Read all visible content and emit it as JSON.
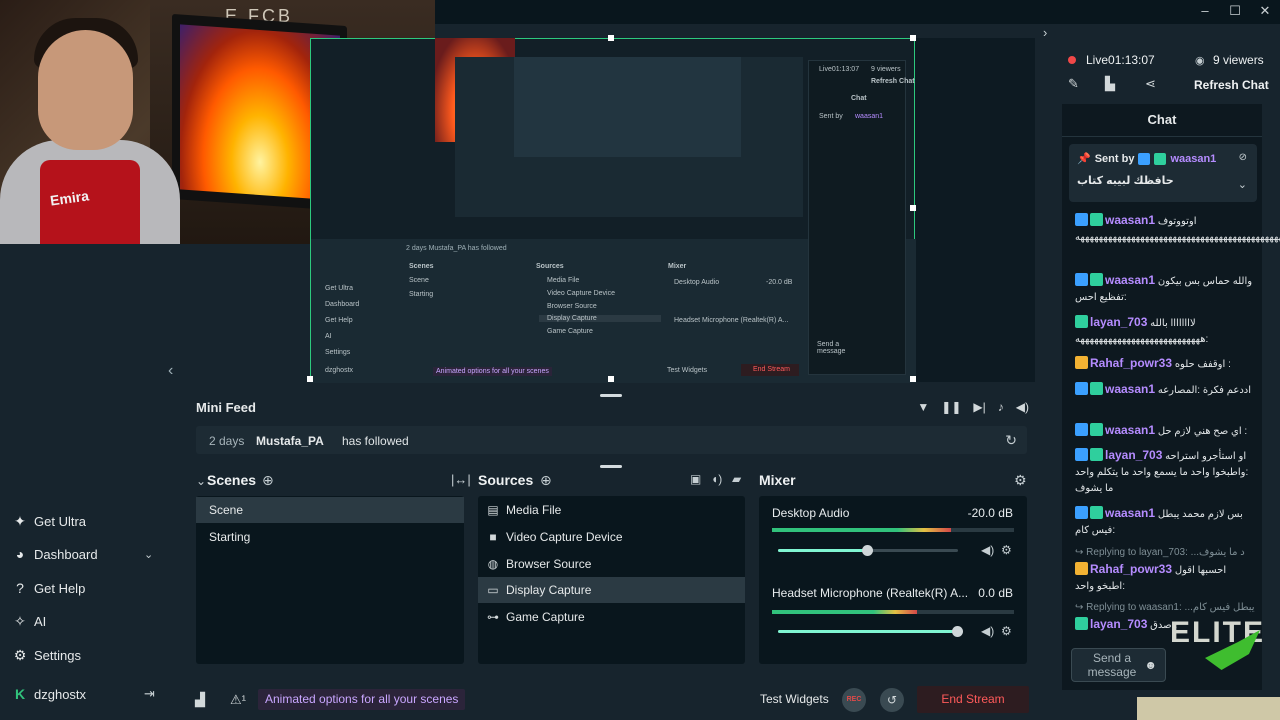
{
  "webcam": {
    "wall_text": "E.FCB",
    "shirt_text": "Emira"
  },
  "window_controls": [
    "–",
    "☐",
    "✕"
  ],
  "preview": {
    "nested_labels": {
      "live": "Live01:13:07",
      "viewers": "9 viewers",
      "refresh": "Refresh Chat",
      "chat": "Chat",
      "sent_by": "Sent by",
      "sent_user": "waasan1",
      "feed": "2 days  Mustafa_PA  has followed",
      "scenes": "Scenes",
      "sources": "Sources",
      "mixer": "Mixer",
      "scene1": "Scene",
      "scene2": "Starting",
      "src": [
        "Media File",
        "Video Capture Device",
        "Browser Source",
        "Display Capture",
        "Game Capture"
      ],
      "mix1": "Desktop Audio",
      "mix1_db": "-20.0 dB",
      "mix2": "Headset Microphone (Realtek(R) A...",
      "side": [
        "Get Ultra",
        "Dashboard",
        "Get Help",
        "AI",
        "Settings",
        "dzghostx"
      ],
      "promo": "Animated options for all your scenes",
      "test": "Test Widgets",
      "end": "End Stream",
      "send": "Send a message"
    }
  },
  "sidebar": {
    "items": [
      {
        "label": "Get Ultra",
        "icon": "ultra-icon"
      },
      {
        "label": "Dashboard",
        "icon": "dashboard-icon"
      },
      {
        "label": "Get Help",
        "icon": "help-icon"
      },
      {
        "label": "AI",
        "icon": "ai-sparkle-icon"
      },
      {
        "label": "Settings",
        "icon": "gear-icon"
      }
    ],
    "account": "dzghostx"
  },
  "minifeed": {
    "title": "Mini Feed",
    "event": {
      "time": "2 days",
      "user": "Mustafa_PA",
      "action": "has followed"
    }
  },
  "scenes": {
    "title": "Scenes",
    "items": [
      "Scene",
      "Starting"
    ],
    "active_index": 0
  },
  "sources": {
    "title": "Sources",
    "items": [
      {
        "label": "Media File",
        "icon": "file-icon"
      },
      {
        "label": "Video Capture Device",
        "icon": "camera-icon"
      },
      {
        "label": "Browser Source",
        "icon": "globe-icon"
      },
      {
        "label": "Display Capture",
        "icon": "monitor-icon"
      },
      {
        "label": "Game Capture",
        "icon": "gamepad-icon"
      }
    ],
    "active_index": 3
  },
  "mixer": {
    "title": "Mixer",
    "channels": [
      {
        "name": "Desktop Audio",
        "db": "-20.0 dB",
        "level": 0.74,
        "volume": 0.5
      },
      {
        "name": "Headset Microphone (Realtek(R) A...",
        "db": "0.0 dB",
        "level": 0.6,
        "volume": 1.0
      }
    ]
  },
  "footer": {
    "promo": "Animated options for all your scenes",
    "test_widgets": "Test Widgets",
    "rec": "REC",
    "end_stream": "End Stream"
  },
  "stream": {
    "live_label": "Live",
    "time": "01:13:07",
    "viewers": "9 viewers",
    "refresh_chat": "Refresh Chat"
  },
  "chat": {
    "title": "Chat",
    "pinned": {
      "sent_by": "Sent by",
      "user": "waasan1",
      "message": "حافظك لبيبه كتاب"
    },
    "messages": [
      {
        "user": "waasan1",
        "color": "#b58cff",
        "badges": [
          "blue",
          "green"
        ],
        "text": "اوتووتوف :ههههههههههههههههههههههههههههههههههههههههههههههههههههههه"
      },
      {
        "user": "waasan1",
        "color": "#b58cff",
        "badges": [
          "blue",
          "green"
        ],
        "text": "والله حماس بس بيكون :تفظيع احس"
      },
      {
        "user": "layan_703",
        "color": "#b58cff",
        "badges": [
          "green"
        ],
        "text": "لاااااااا بالله :هههههههههههههههههههههههههههه"
      },
      {
        "user": "Rahaf_powr33",
        "color": "#b58cff",
        "badges": [
          "gold"
        ],
        "text": "اوقفف حلوه :"
      },
      {
        "user": "waasan1",
        "color": "#b58cff",
        "badges": [
          "blue",
          "green"
        ],
        "text": "اددعم فكرة :المصارعه"
      },
      {
        "user": "waasan1",
        "color": "#b58cff",
        "badges": [
          "blue",
          "green"
        ],
        "text": "اي صح هني لازم حل :"
      },
      {
        "user": "layan_703",
        "color": "#b58cff",
        "badges": [
          "blue",
          "green"
        ],
        "text": "او استأجرو استراحه :واطبخوا واحد ما يسمع واحد ما يتكلم واحد ما يشوف"
      },
      {
        "user": "waasan1",
        "color": "#b58cff",
        "badges": [
          "blue",
          "green"
        ],
        "text": "بس لازم محمد يبطل :فيس كام"
      }
    ],
    "replies": [
      {
        "reply_to": "Replying to layan_703: ...د ما يشوف",
        "user": "Rahaf_powr33",
        "badges": [
          "gold"
        ],
        "text": "احسبها اقول :اطبخو واحد"
      },
      {
        "reply_to": "Replying to waasan1: ...يبطل فيس كام",
        "user": "layan_703",
        "badges": [
          "green"
        ],
        "text": "صدق :"
      }
    ],
    "input_placeholder": "Send a message"
  },
  "overlay": {
    "brand": "ELITE"
  }
}
